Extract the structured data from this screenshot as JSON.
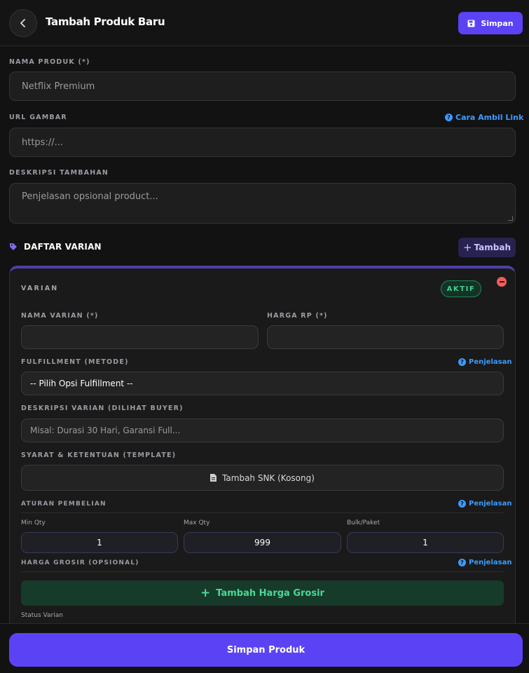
{
  "header": {
    "title": "Tambah Produk Baru",
    "save_label": "Simpan"
  },
  "product_name": {
    "label": "NAMA PRODUK (*)",
    "value": "Netflix Premium"
  },
  "image_url": {
    "label": "URL GAMBAR",
    "placeholder": "https://...",
    "help_link": "Cara Ambil Link"
  },
  "description": {
    "label": "DESKRIPSI TAMBAHAN",
    "placeholder": "Penjelasan opsional product..."
  },
  "variants": {
    "title": "DAFTAR VARIAN",
    "add_label": "Tambah",
    "card": {
      "title": "VARIAN",
      "status_badge": "AKTIF",
      "name_label": "NAMA VARIAN (*)",
      "price_label": "HARGA RP (*)",
      "fulfillment_label": "FULFILLMENT (METODE)",
      "fulfillment_help": "Penjelasan",
      "fulfillment_value": "-- Pilih Opsi Fulfillment --",
      "desc_label": "DESKRIPSI VARIAN (DILIHAT BUYER)",
      "desc_placeholder": "Misal: Durasi 30 Hari, Garansi Full...",
      "snk_label": "SYARAT & KETENTUAN (TEMPLATE)",
      "snk_button": "Tambah SNK (Kosong)",
      "rules_label": "ATURAN PEMBELIAN",
      "rules_help": "Penjelasan",
      "min_qty_label": "Min Qty",
      "min_qty": "1",
      "max_qty_label": "Max Qty",
      "max_qty": "999",
      "bulk_label": "Bulk/Paket",
      "bulk": "1",
      "grosir_label": "HARGA GROSIR (OPSIONAL)",
      "grosir_help": "Penjelasan",
      "grosir_button": "Tambah Harga Grosir",
      "status_label": "Status Varian"
    }
  },
  "footer": {
    "save_label": "Simpan Produk"
  },
  "colors": {
    "accent": "#5b43f5",
    "link": "#3b9bff",
    "success": "#3fd28e",
    "danger": "#f25c5c"
  },
  "icons": [
    "chevron-left-icon",
    "save-icon",
    "question-icon",
    "tag-icon",
    "plus-icon",
    "file-icon",
    "minus-icon"
  ]
}
